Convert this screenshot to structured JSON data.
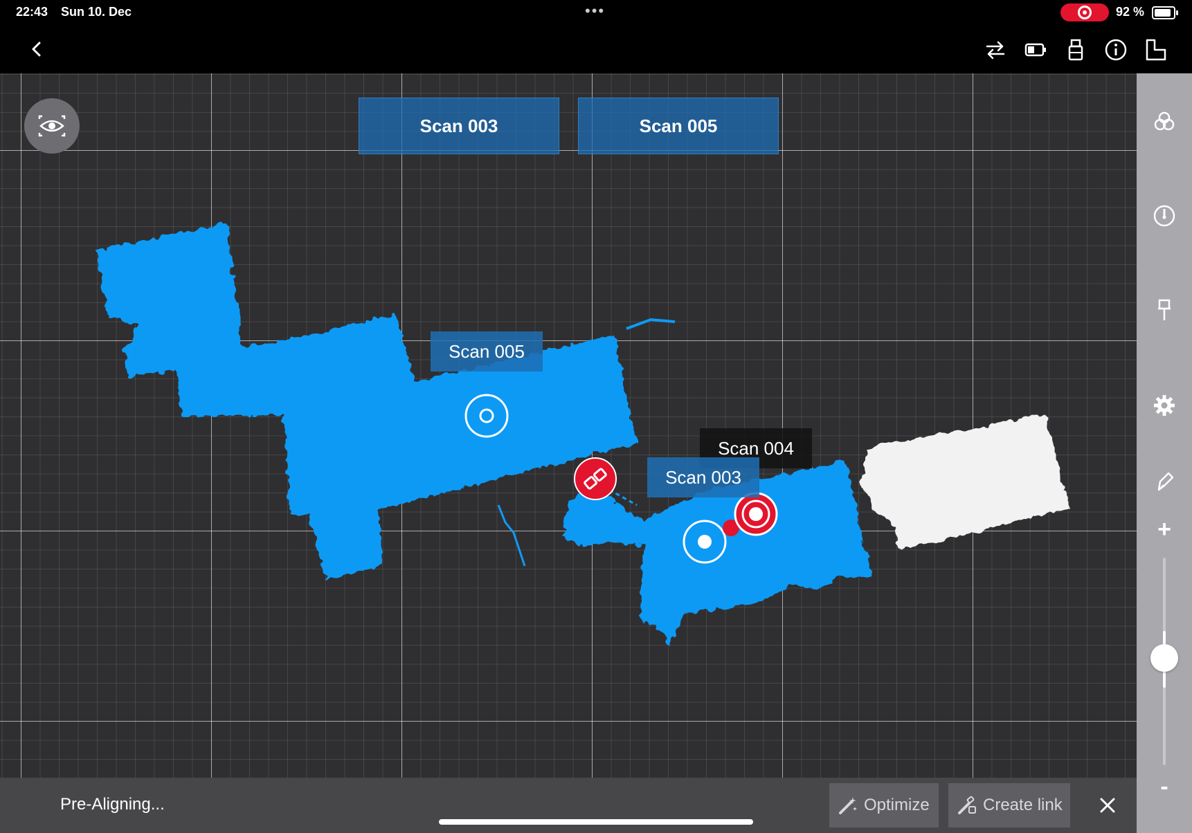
{
  "status_bar": {
    "time": "22:43",
    "date": "Sun 10. Dec",
    "battery_percent": "92 %",
    "battery_level": 0.92,
    "more_icon": "ellipsis-icon",
    "recording_icon": "screen-record-icon"
  },
  "toolbar": {
    "back_icon": "chevron-left-icon",
    "icons": [
      "swap-arrows-icon",
      "battery-device-icon",
      "usb-drive-icon",
      "info-icon",
      "floorplan-icon"
    ]
  },
  "map": {
    "tabs": [
      {
        "label": "Scan 003"
      },
      {
        "label": "Scan 005"
      }
    ],
    "labels": {
      "scan005": "Scan 005",
      "scan004": "Scan 004",
      "scan003": "Scan 003"
    },
    "eye_icon": "eye-view-icon"
  },
  "rail": {
    "icons": [
      "layers-icon",
      "compass-icon",
      "pin-icon",
      "gear-icon",
      "pen-icon"
    ],
    "zoom_in": "+",
    "zoom_out": "-",
    "zoom_level": 0.45
  },
  "bottom_bar": {
    "status": "Pre-Aligning...",
    "optimize_label": "Optimize",
    "create_link_label": "Create link",
    "close_icon": "close-icon"
  },
  "colors": {
    "scan_blue": "#0f9af5",
    "accent_red": "#e3142e",
    "map_background": "#2f2f31"
  }
}
